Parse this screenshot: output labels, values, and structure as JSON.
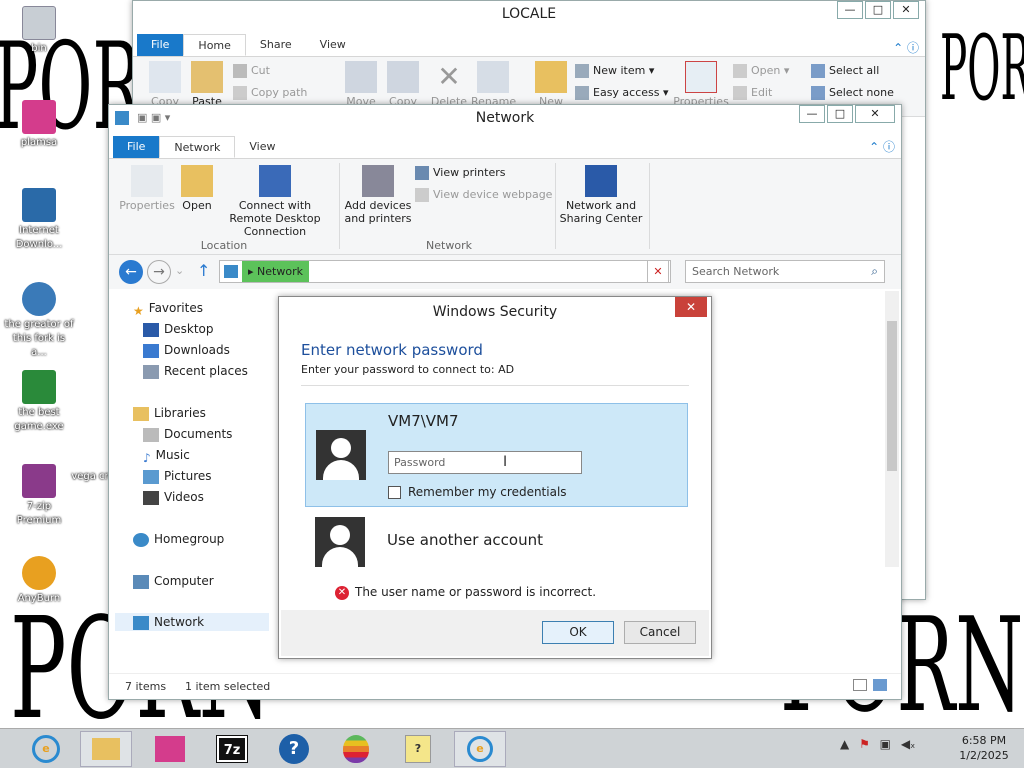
{
  "wallpaper": {
    "top_text": "PORN",
    "bottom_text": "PORN",
    "right_top_text": "PORN",
    "bottom_right_text": "PORN"
  },
  "desktop_icons": [
    {
      "label": "bin",
      "icon": "recycle-bin-icon",
      "color": "#7a8a9a"
    },
    {
      "label": "plamsa",
      "icon": "plasma-icon",
      "color": "#d43c8c"
    },
    {
      "label": "Internet Downlo...",
      "icon": "download-manager-icon",
      "color": "#2a6aa8"
    },
    {
      "label": "the greator of this fork is a...",
      "icon": "globe-icon",
      "color": "#3a7ab8"
    },
    {
      "label": "the best game.exe",
      "icon": "game-icon",
      "color": "#2a8a3a"
    },
    {
      "label": "7-zip Premium",
      "icon": "winrar-icon",
      "color": "#8a3a8a"
    },
    {
      "label": "AnyBurn",
      "icon": "anyburn-icon",
      "color": "#e8a020"
    },
    {
      "label": "vega cr",
      "icon": "vegas-icon",
      "color": "#555"
    }
  ],
  "locale_window": {
    "title": "LOCALE",
    "tabs": [
      "File",
      "Home",
      "Share",
      "View"
    ],
    "active_tab": "Home",
    "ribbon": {
      "copy": "Copy",
      "paste": "Paste",
      "cut": "Cut",
      "copy_path": "Copy path",
      "move": "Move",
      "copy_to": "Copy",
      "delete": "Delete",
      "rename": "Rename",
      "new": "New",
      "new_item": "New item ▾",
      "easy_access": "Easy access ▾",
      "properties": "Properties",
      "open": "Open ▾",
      "edit": "Edit",
      "select_all": "Select all",
      "select_none": "Select none"
    }
  },
  "network_window": {
    "title": "Network",
    "tabs": [
      "File",
      "Network",
      "View"
    ],
    "active_tab": "Network",
    "ribbon": {
      "properties": "Properties",
      "open": "Open",
      "connect_remote": "Connect with Remote Desktop Connection",
      "add_devices": "Add devices and printers",
      "view_printers": "View printers",
      "view_device_webpage": "View device webpage",
      "network_sharing": "Network and Sharing Center",
      "group_location": "Location",
      "group_network": "Network"
    },
    "address": {
      "path": "Network",
      "search_placeholder": "Search Network"
    },
    "nav": {
      "favorites": "Favorites",
      "desktop": "Desktop",
      "downloads": "Downloads",
      "recent": "Recent places",
      "libraries": "Libraries",
      "documents": "Documents",
      "music": "Music",
      "pictures": "Pictures",
      "videos": "Videos",
      "homegroup": "Homegroup",
      "computer": "Computer",
      "network": "Network"
    },
    "status": {
      "items": "7 items",
      "selected": "1 item selected"
    }
  },
  "dialog": {
    "title": "Windows Security",
    "heading": "Enter network password",
    "subheading": "Enter your password to connect to: AD",
    "account_name": "VM7\\VM7",
    "password_placeholder": "Password",
    "remember_label": "Remember my credentials",
    "other_account": "Use another account",
    "error": "The user name or password is incorrect.",
    "ok": "OK",
    "cancel": "Cancel"
  },
  "taskbar": {
    "time": "6:58 PM",
    "date": "1/2/2025",
    "apps": [
      "ie-icon",
      "file-explorer-icon",
      "plasma-icon",
      "7zip-icon",
      "help-icon",
      "apple-icon",
      "help-doc-icon",
      "ie-icon"
    ]
  }
}
